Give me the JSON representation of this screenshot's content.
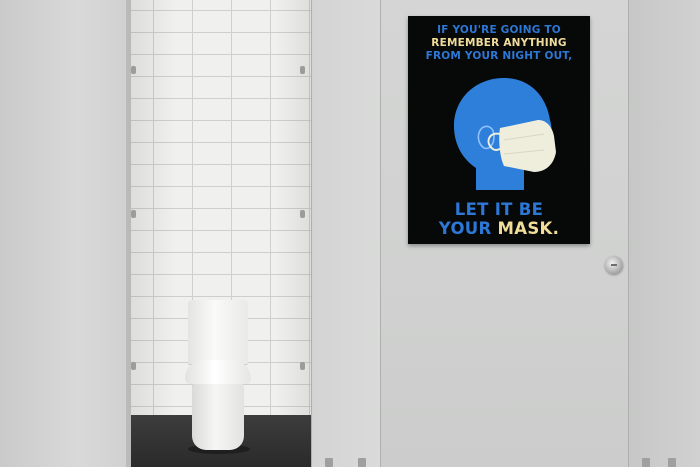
{
  "poster": {
    "top_line_1": "IF YOU'RE GOING TO",
    "top_line_2": "REMEMBER ANYTHING",
    "top_line_3": "FROM YOUR NIGHT OUT,",
    "bottom_line_1": "LET IT BE",
    "bottom_line_2_part_a": "YOUR",
    "bottom_line_2_part_b": "MASK."
  },
  "colors": {
    "poster_background": "#070808",
    "blue_text": "#2d78d6",
    "highlight_text": "#f1dd9a",
    "head_silhouette": "#2d7fd9",
    "mask": "#efeedd",
    "stall_panel": "#d0d1d0"
  },
  "icons": {
    "poster_art": "head-with-face-mask-icon",
    "lock": "door-lock-knob-icon"
  }
}
